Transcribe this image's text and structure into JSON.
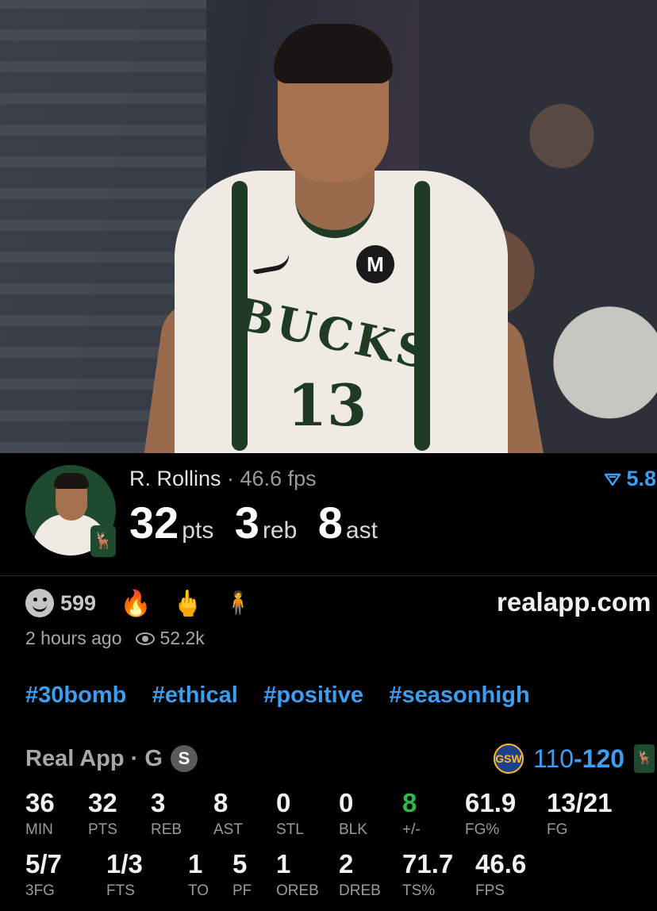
{
  "player": {
    "name": "R. Rollins",
    "fps_text": "46.6 fps",
    "pts": "32",
    "pts_unit": "pts",
    "reb": "3",
    "reb_unit": "reb",
    "ast": "8",
    "ast_unit": "ast",
    "rating": "5.8"
  },
  "photo": {
    "jersey_text": "BUCKS",
    "jersey_number": "13"
  },
  "reactions": {
    "count": "599",
    "fire": "🔥",
    "finger": "🖕",
    "referee": "🧍"
  },
  "site": "realapp.com",
  "meta": {
    "time_ago": "2 hours ago",
    "views": "52.2k"
  },
  "tags": [
    "#30bomb",
    "#ethical",
    "#positive",
    "#seasonhigh"
  ],
  "game": {
    "source": "Real App · G",
    "badge": "S",
    "away_score": "110",
    "dash": "-",
    "home_score": "120"
  },
  "stats_row1": [
    {
      "v": "36",
      "l": "MIN"
    },
    {
      "v": "32",
      "l": "PTS"
    },
    {
      "v": "3",
      "l": "REB"
    },
    {
      "v": "8",
      "l": "AST"
    },
    {
      "v": "0",
      "l": "STL"
    },
    {
      "v": "0",
      "l": "BLK"
    },
    {
      "v": "8",
      "l": "+/-"
    },
    {
      "v": "61.9",
      "l": "FG%"
    },
    {
      "v": "13/21",
      "l": "FG"
    }
  ],
  "stats_row2": [
    {
      "v": "5/7",
      "l": "3FG"
    },
    {
      "v": "1/3",
      "l": "FTS"
    },
    {
      "v": "1",
      "l": "TO"
    },
    {
      "v": "5",
      "l": "PF"
    },
    {
      "v": "1",
      "l": "OREB"
    },
    {
      "v": "2",
      "l": "DREB"
    },
    {
      "v": "71.7",
      "l": "TS%"
    },
    {
      "v": "46.6",
      "l": "FPS"
    }
  ],
  "colors": {
    "accent_blue": "#3a9ef2",
    "positive_green": "#2fb84c",
    "bucks_green": "#1e4a30"
  },
  "icons": [
    "smile-icon",
    "fire-icon",
    "middle-finger-icon",
    "referee-icon",
    "eye-icon",
    "rating-down-icon",
    "warriors-logo-icon",
    "bucks-logo-icon"
  ]
}
